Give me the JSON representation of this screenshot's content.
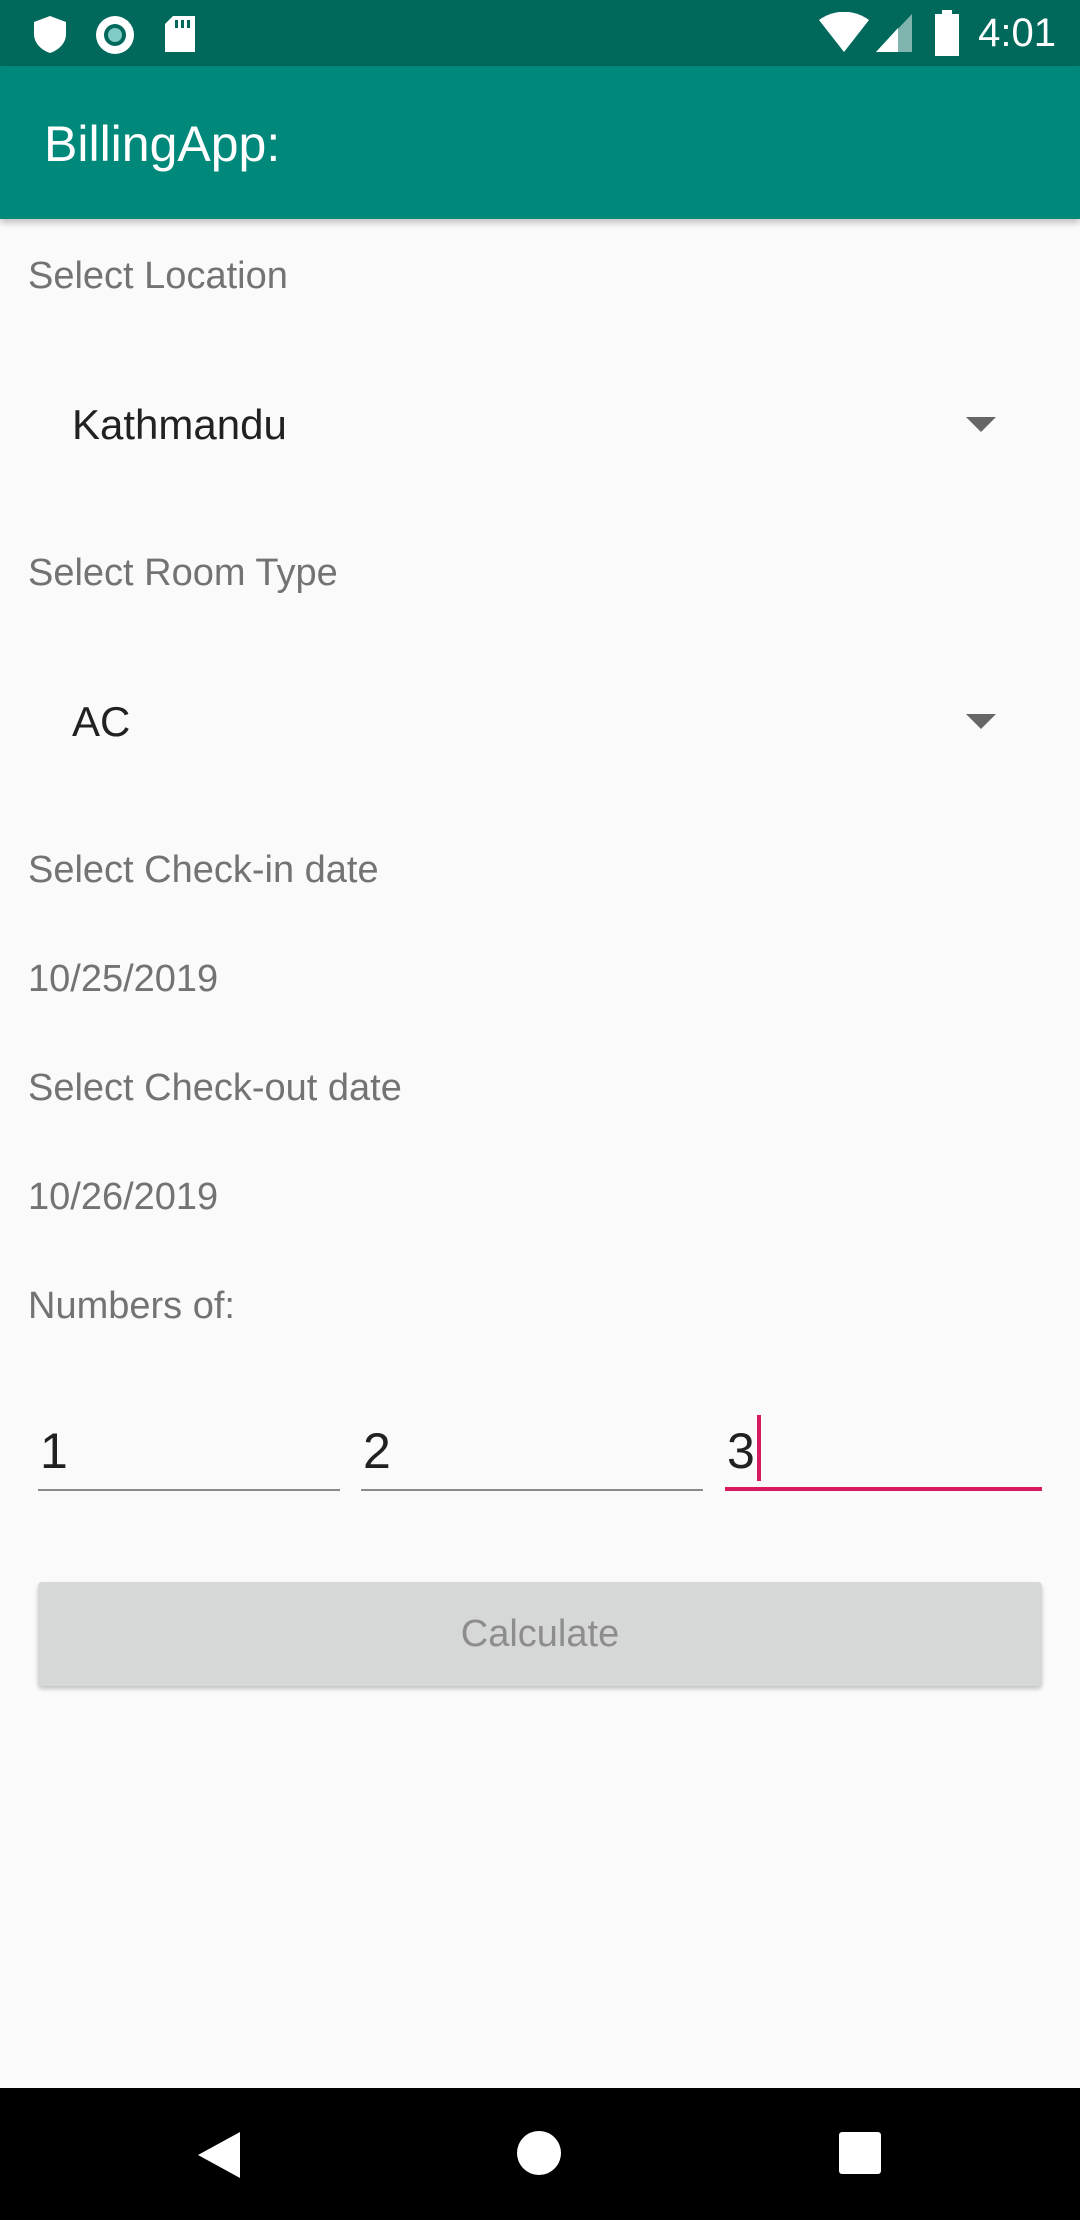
{
  "status_bar": {
    "time": "4:01",
    "left_icons": [
      "shield-icon",
      "sync-circle-icon",
      "sd-card-icon"
    ],
    "right_icons": [
      "wifi-icon",
      "signal-icon",
      "battery-icon"
    ]
  },
  "app_bar": {
    "title": "BillingApp:",
    "color": "#00897b",
    "status_color": "#00695c"
  },
  "form": {
    "location_label": "Select Location",
    "location_value": "Kathmandu",
    "room_type_label": "Select Room Type",
    "room_type_value": "AC",
    "checkin_label": "Select Check-in date",
    "checkin_value": "10/25/2019",
    "checkout_label": "Select Check-out date",
    "checkout_value": "10/26/2019",
    "numbers_label": "Numbers of:",
    "number_fields": [
      "1",
      "2",
      "3"
    ],
    "focused_field": 3,
    "accent_color": "#d81b60",
    "calculate_label": "Calculate"
  },
  "nav_bar": {
    "icons": [
      "back-icon",
      "home-icon",
      "recents-icon"
    ]
  }
}
